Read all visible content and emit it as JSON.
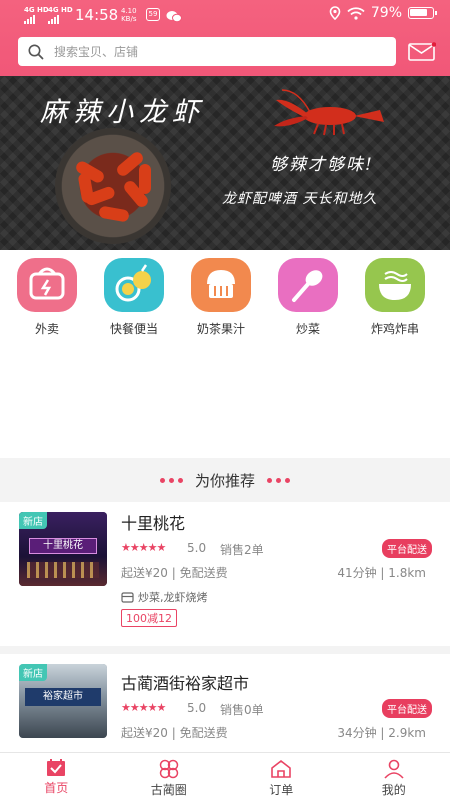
{
  "status_bar": {
    "network1": "4G HD",
    "network2": "4G HD",
    "time": "14:58",
    "speed_value": "4.10",
    "speed_unit": "KB/s",
    "battery": "79%"
  },
  "search": {
    "placeholder": "搜索宝贝、店铺"
  },
  "banner": {
    "title": "麻辣小龙虾",
    "tagline1": "够辣才够味!",
    "tagline2": "龙虾配啤酒 天长和地久"
  },
  "categories": [
    {
      "label": "外卖",
      "icon": "takeout-box-icon",
      "color": "#ef6f8a"
    },
    {
      "label": "快餐便当",
      "icon": "fruit-icon",
      "color": "#39c0cf"
    },
    {
      "label": "奶茶果汁",
      "icon": "cake-icon",
      "color": "#f2894e"
    },
    {
      "label": "炒菜",
      "icon": "spatula-icon",
      "color": "#e96fc1"
    },
    {
      "label": "炸鸡炸串",
      "icon": "bowl-icon",
      "color": "#96c64e"
    }
  ],
  "section": {
    "title": "为你推荐"
  },
  "shops": [
    {
      "badge": "新店",
      "name": "十里桃花",
      "stars": "★★★★★",
      "rating": "5.0",
      "sales": "销售2单",
      "platform": "平台配送",
      "fee": "起送¥20 | 免配送费",
      "eta": "41分钟 | 1.8km",
      "tags": "炒菜,龙虾烧烤",
      "promo": "100减12",
      "sign_text": "十里桃花"
    },
    {
      "badge": "新店",
      "name": "古蔺酒街裕家超市",
      "stars": "★★★★★",
      "rating": "5.0",
      "sales": "销售0单",
      "platform": "平台配送",
      "fee": "起送¥20 | 免配送费",
      "eta": "34分钟 | 2.9km",
      "sign_text": "裕家超市"
    }
  ],
  "nav": [
    {
      "label": "首页",
      "icon": "home-icon",
      "active": true
    },
    {
      "label": "古蔺圈",
      "icon": "circles-icon",
      "active": false
    },
    {
      "label": "订单",
      "icon": "order-house-icon",
      "active": false
    },
    {
      "label": "我的",
      "icon": "profile-icon",
      "active": false
    }
  ],
  "colors": {
    "brand": "#f15778",
    "accent": "#e94464"
  }
}
